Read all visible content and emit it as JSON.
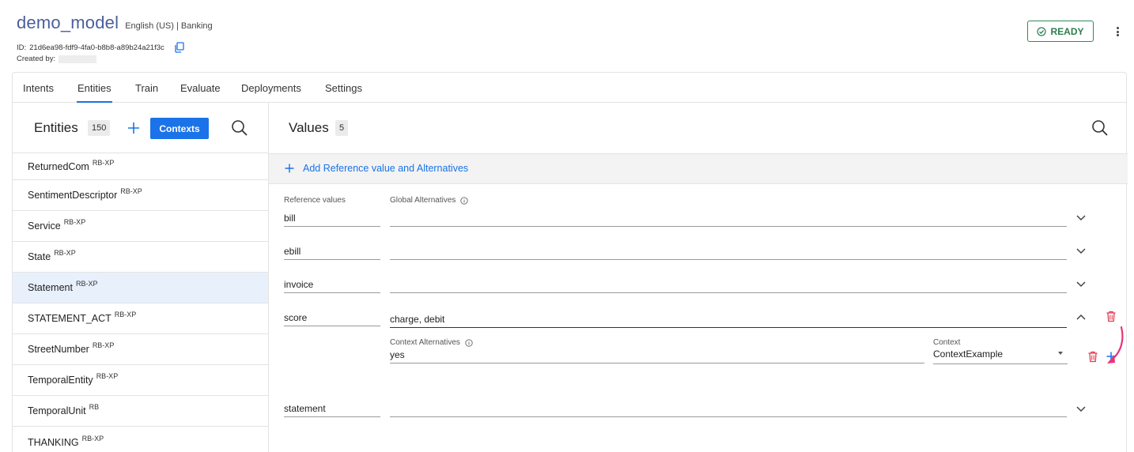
{
  "model": {
    "name": "demo_model",
    "meta": "English (US) | Banking",
    "id_label": "ID:",
    "id_value": "21d6ea98-fdf9-4fa0-b8b8-a89b24a21f3c",
    "created_label": "Created by:",
    "status": "READY"
  },
  "tabs": [
    {
      "label": "Intents"
    },
    {
      "label": "Entities"
    },
    {
      "label": "Train"
    },
    {
      "label": "Evaluate"
    },
    {
      "label": "Deployments"
    },
    {
      "label": "Settings"
    }
  ],
  "entities_panel": {
    "title": "Entities",
    "count": "150",
    "contexts_label": "Contexts",
    "items": [
      {
        "name": "ReturnedCom",
        "tag": "RB-XP"
      },
      {
        "name": "SentimentDescriptor",
        "tag": "RB-XP"
      },
      {
        "name": "Service",
        "tag": "RB-XP"
      },
      {
        "name": "State",
        "tag": "RB-XP"
      },
      {
        "name": "Statement",
        "tag": "RB-XP"
      },
      {
        "name": "STATEMENT_ACT",
        "tag": "RB-XP"
      },
      {
        "name": "StreetNumber",
        "tag": "RB-XP"
      },
      {
        "name": "TemporalEntity",
        "tag": "RB-XP"
      },
      {
        "name": "TemporalUnit",
        "tag": "RB"
      },
      {
        "name": "THANKING",
        "tag": "RB-XP"
      }
    ],
    "selected": "Statement"
  },
  "values_panel": {
    "title": "Values",
    "count": "5",
    "add_label": "Add Reference value and Alternatives",
    "col_reference": "Reference values",
    "col_global": "Global Alternatives",
    "col_context_alt": "Context Alternatives",
    "col_context": "Context",
    "rows": [
      {
        "reference": "bill",
        "alternatives": ""
      },
      {
        "reference": "ebill",
        "alternatives": ""
      },
      {
        "reference": "invoice",
        "alternatives": ""
      },
      {
        "reference": "score",
        "alternatives": "charge, debit"
      },
      {
        "reference": "statement",
        "alternatives": ""
      }
    ],
    "context_alt_value": "yes",
    "context_value": "ContextExample"
  },
  "colors": {
    "accent": "#1a73e8",
    "ready": "#2e7d4f",
    "danger": "#e53950",
    "annotation": "#e8357a",
    "selected_row": "#e8f0fc"
  }
}
